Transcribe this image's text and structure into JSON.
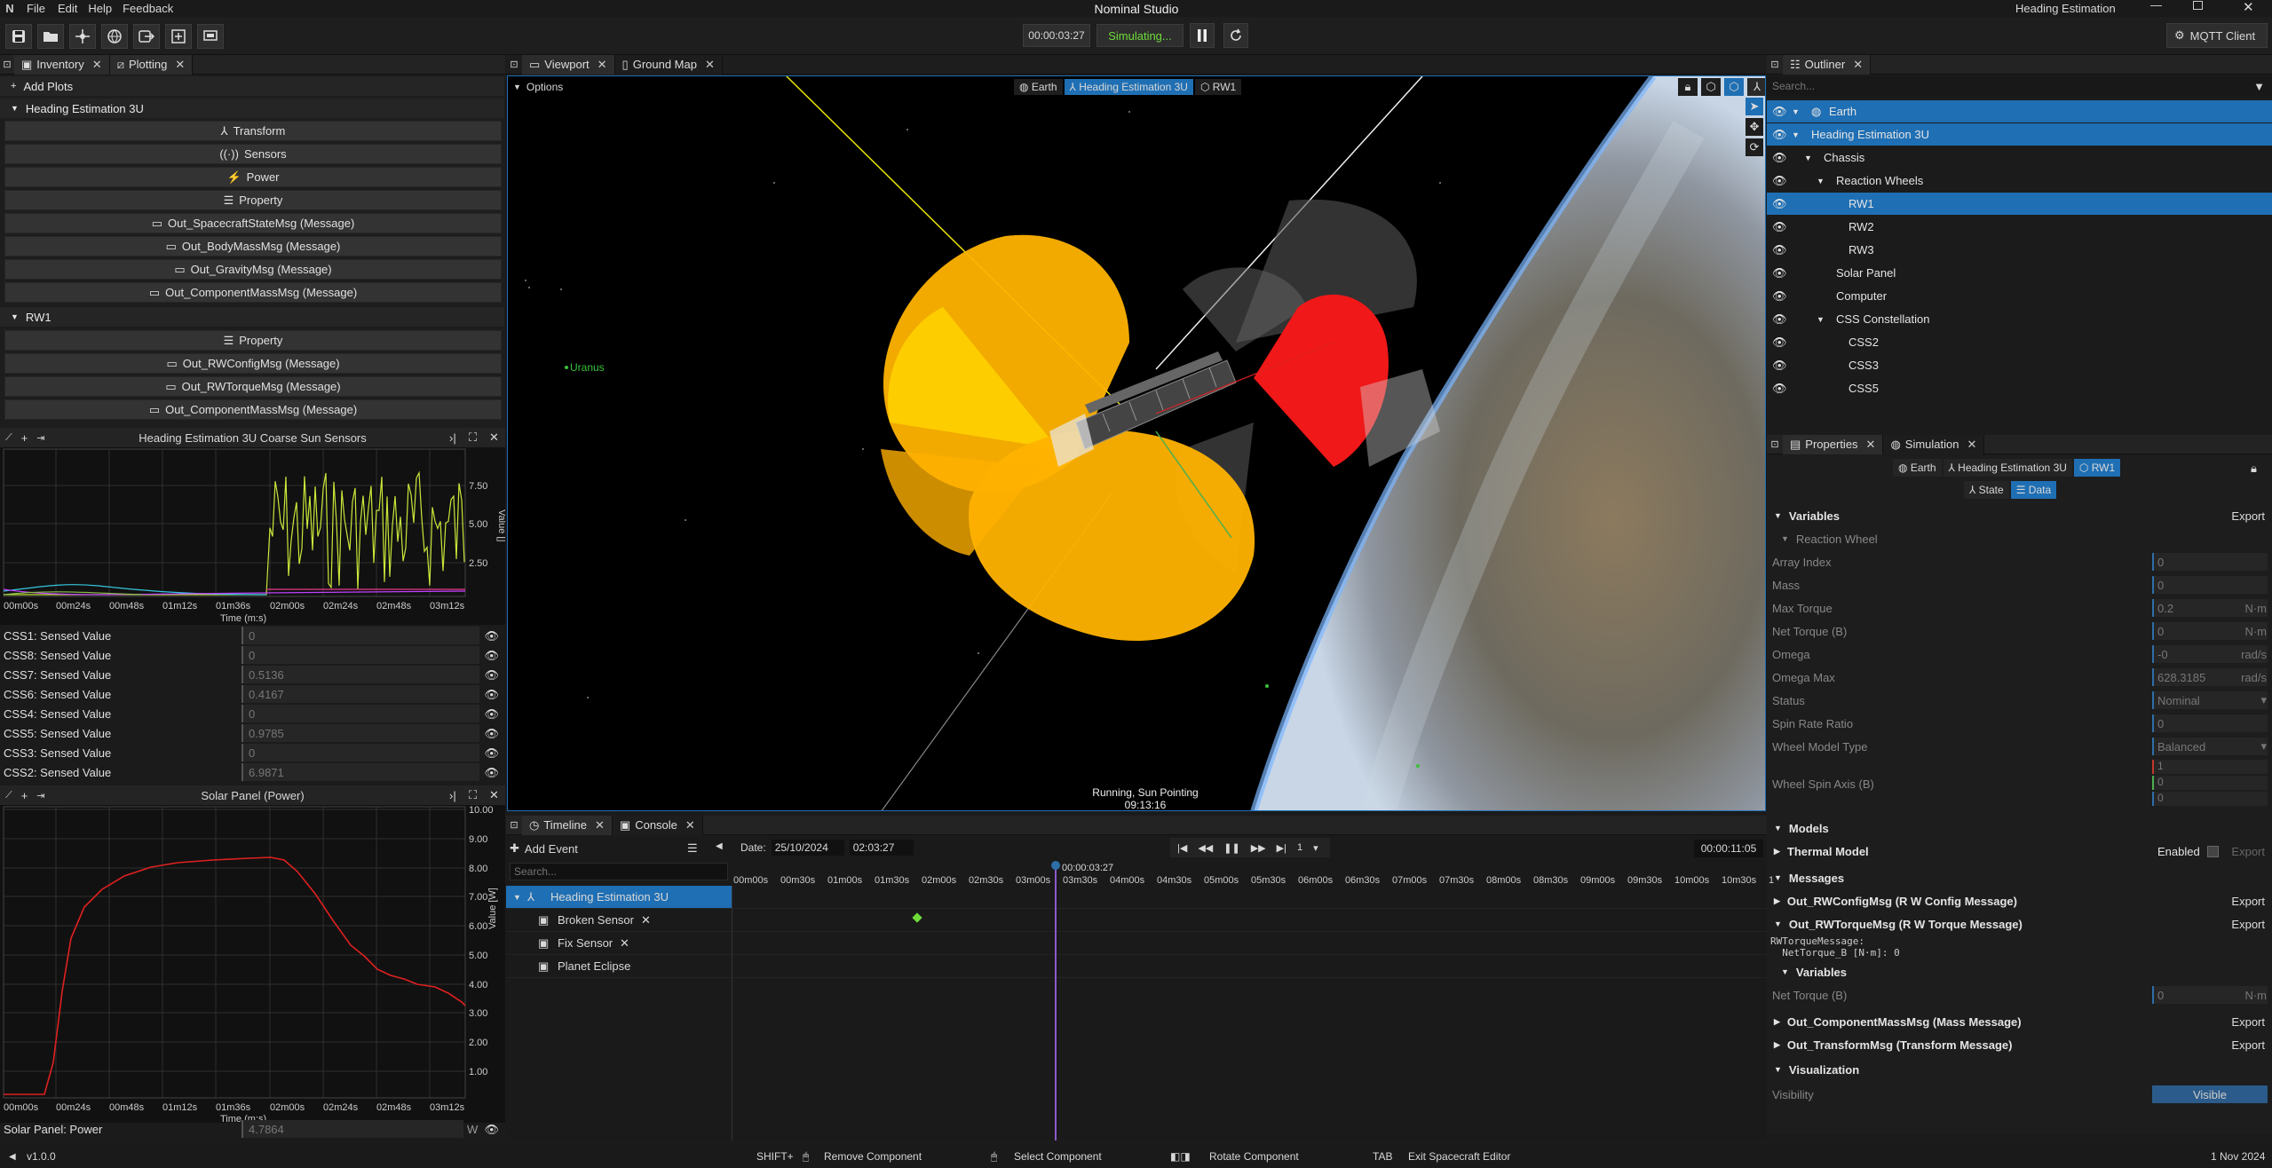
{
  "menu": {
    "file": "File",
    "edit": "Edit",
    "help": "Help",
    "feedback": "Feedback",
    "app_title": "Nominal Studio",
    "project": "Heading Estimation"
  },
  "toolbar": {
    "sim_time": "00:00:03:27",
    "sim_status": "Simulating...",
    "mqtt": "MQTT Client"
  },
  "left": {
    "tabs": [
      "Inventory",
      "Plotting"
    ],
    "add_plots": "Add Plots",
    "group1": {
      "title": "Heading Estimation 3U",
      "items": [
        "Transform",
        "Sensors",
        "Power",
        "Property",
        "Out_SpacecraftStateMsg (Message)",
        "Out_BodyMassMsg (Message)",
        "Out_GravityMsg (Message)",
        "Out_ComponentMassMsg (Message)"
      ]
    },
    "group2": {
      "title": "RW1",
      "items": [
        "Property",
        "Out_RWConfigMsg (Message)",
        "Out_RWTorqueMsg (Message)",
        "Out_ComponentMassMsg (Message)"
      ]
    }
  },
  "plot1": {
    "title": "Heading Estimation 3U Coarse Sun Sensors",
    "xlabel": "Time (m:s)",
    "ylabel": "Value []",
    "yticks": [
      "7.50",
      "5.00",
      "2.50"
    ],
    "xticks": [
      "00m00s",
      "00m24s",
      "00m48s",
      "01m12s",
      "01m36s",
      "02m00s",
      "02m24s",
      "02m48s",
      "03m12s"
    ],
    "values": [
      {
        "label": "CSS1: Sensed Value",
        "value": "0"
      },
      {
        "label": "CSS8: Sensed Value",
        "value": "0"
      },
      {
        "label": "CSS7: Sensed Value",
        "value": "0.5136"
      },
      {
        "label": "CSS6: Sensed Value",
        "value": "0.4167"
      },
      {
        "label": "CSS4: Sensed Value",
        "value": "0"
      },
      {
        "label": "CSS5: Sensed Value",
        "value": "0.9785"
      },
      {
        "label": "CSS3: Sensed Value",
        "value": "0"
      },
      {
        "label": "CSS2: Sensed Value",
        "value": "6.9871"
      }
    ]
  },
  "plot2": {
    "title": "Solar Panel (Power)",
    "xlabel": "Time (m:s)",
    "ylabel": "Value [W]",
    "yticks": [
      "10.00",
      "9.00",
      "8.00",
      "7.00",
      "6.00",
      "5.00",
      "4.00",
      "3.00",
      "2.00",
      "1.00"
    ],
    "xticks": [
      "00m00s",
      "00m24s",
      "00m48s",
      "01m12s",
      "01m36s",
      "02m00s",
      "02m24s",
      "02m48s",
      "03m12s"
    ],
    "value_label": "Solar Panel: Power",
    "value": "4.7864",
    "unit": "W"
  },
  "viewport": {
    "tabs": [
      "Viewport",
      "Ground Map"
    ],
    "options": "Options",
    "crumbs": [
      "Earth",
      "Heading Estimation 3U",
      "RW1"
    ],
    "uranus": "Uranus",
    "status1": "Running, Sun Pointing",
    "status2": "09:13:16"
  },
  "outliner": {
    "tab": "Outliner",
    "search": "Search...",
    "items": [
      {
        "label": "Earth",
        "depth": 0,
        "arrow": true,
        "sel": true,
        "icon": true
      },
      {
        "label": "Heading Estimation 3U",
        "depth": 0,
        "arrow": true,
        "sel": true
      },
      {
        "label": "Chassis",
        "depth": 1,
        "arrow": true
      },
      {
        "label": "Reaction Wheels",
        "depth": 2,
        "arrow": true
      },
      {
        "label": "RW1",
        "depth": 3,
        "sel": true
      },
      {
        "label": "RW2",
        "depth": 3
      },
      {
        "label": "RW3",
        "depth": 3
      },
      {
        "label": "Solar Panel",
        "depth": 2
      },
      {
        "label": "Computer",
        "depth": 2
      },
      {
        "label": "CSS Constellation",
        "depth": 2,
        "arrow": true
      },
      {
        "label": "CSS2",
        "depth": 3
      },
      {
        "label": "CSS3",
        "depth": 3
      },
      {
        "label": "CSS5",
        "depth": 3
      }
    ]
  },
  "properties": {
    "tabs": [
      "Properties",
      "Simulation"
    ],
    "crumbs": [
      "Earth",
      "Heading Estimation 3U",
      "RW1"
    ],
    "subtabs": [
      "State",
      "Data"
    ],
    "variables": "Variables",
    "export": "Export",
    "reaction_wheel": "Reaction Wheel",
    "fields": [
      {
        "label": "Array Index",
        "value": "0",
        "unit": ""
      },
      {
        "label": "Mass",
        "value": "0",
        "unit": ""
      },
      {
        "label": "Max Torque",
        "value": "0.2",
        "unit": "N·m"
      },
      {
        "label": "Net Torque (B)",
        "value": "0",
        "unit": "N·m"
      },
      {
        "label": "Omega",
        "value": "-0",
        "unit": "rad/s"
      },
      {
        "label": "Omega Max",
        "value": "628.3185",
        "unit": "rad/s"
      },
      {
        "label": "Status",
        "value": "Nominal",
        "unit": "▾"
      },
      {
        "label": "Spin Rate Ratio",
        "value": "0",
        "unit": ""
      },
      {
        "label": "Wheel Model Type",
        "value": "Balanced",
        "unit": "▾"
      }
    ],
    "spin_axis": {
      "label": "Wheel Spin Axis (B)",
      "values": [
        "1",
        "0",
        "0"
      ]
    },
    "models": "Models",
    "thermal": "Thermal Model",
    "enabled": "Enabled",
    "messages": "Messages",
    "msg1": "Out_RWConfigMsg (R W Config Message)",
    "msg2": "Out_RWTorqueMsg (R W Torque Message)",
    "code1": "RWTorqueMessage:",
    "code2": "  NetTorque_B [N·m]: 0",
    "subvars": "Variables",
    "nt_label": "Net Torque (B)",
    "nt_value": "0",
    "nt_unit": "N·m",
    "msg3": "Out_ComponentMassMsg (Mass Message)",
    "msg4": "Out_TransformMsg (Transform Message)",
    "visualization": "Visualization",
    "visibility": "Visibility",
    "visible": "Visible"
  },
  "timeline": {
    "tabs": [
      "Timeline",
      "Console"
    ],
    "add_event": "Add Event",
    "search": "Search...",
    "date_label": "Date:",
    "date": "25/10/2024",
    "time": "02:03:27",
    "speed": "1",
    "end": "00:00:11:05",
    "cursor": "00:00:03:27",
    "ticks": [
      "00m00s",
      "00m30s",
      "01m00s",
      "01m30s",
      "02m00s",
      "02m30s",
      "03m00s",
      "03m30s",
      "04m00s",
      "04m30s",
      "05m00s",
      "05m30s",
      "06m00s",
      "06m30s",
      "07m00s",
      "07m30s",
      "08m00s",
      "08m30s",
      "09m00s",
      "09m30s",
      "10m00s",
      "10m30s",
      "1"
    ],
    "root": "Heading Estimation 3U",
    "events": [
      "Broken Sensor",
      "Fix Sensor",
      "Planet Eclipse"
    ]
  },
  "status": {
    "version": "v1.0.0",
    "h1k": "SHIFT+",
    "h1": "Remove Component",
    "h2": "Select Component",
    "h3": "Rotate Component",
    "h4k": "TAB",
    "h4": "Exit Spacecraft Editor",
    "date": "1 Nov 2024"
  },
  "colors": {
    "accent": "#1f6fb4",
    "sim": "#6fdc3a",
    "css_line": "#c8e83a",
    "power_line": "#e02020"
  }
}
